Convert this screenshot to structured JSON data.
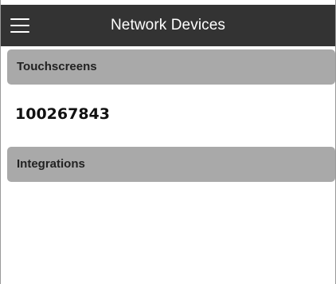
{
  "header": {
    "title": "Network Devices",
    "menu_icon": "hamburger-menu-icon"
  },
  "sections": [
    {
      "label": "Touchscreens",
      "items": [
        "100267843"
      ]
    },
    {
      "label": "Integrations",
      "items": []
    }
  ],
  "colors": {
    "header_bg": "#333333",
    "section_bg": "#a9a9a9",
    "header_text": "#ffffff"
  }
}
